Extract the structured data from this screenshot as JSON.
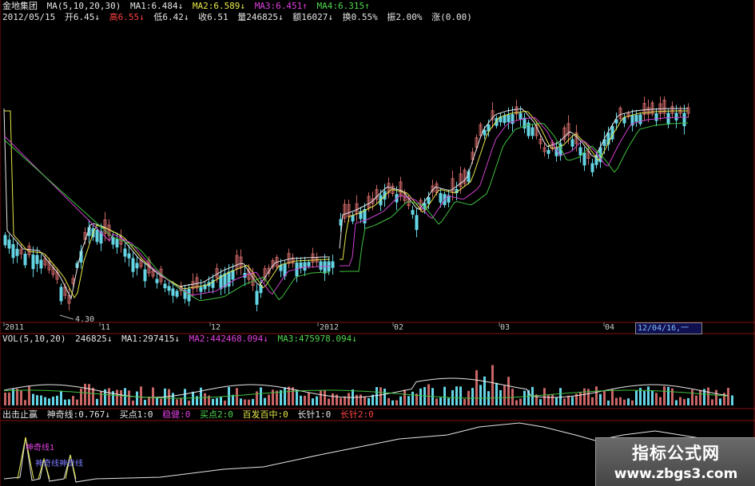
{
  "header": {
    "stock_name": "金地集团",
    "ma": "MA(5,10,20,30)",
    "ma1": "MA1:6.484↓",
    "ma2": "MA2:6.589↓",
    "ma3": "MA3:6.451↑",
    "ma4": "MA4:6.315↑",
    "date": "2012/05/15",
    "open": "开6.45↓",
    "high": "高6.55↓",
    "low": "低6.42↓",
    "close": "收6.51",
    "volume": "量246825↓",
    "amount": "额16027↓",
    "turnover": "换0.55%",
    "amplitude": "振2.00%",
    "change": "涨(0.00)"
  },
  "price_panel": {
    "low_marker": "4.30",
    "date_box": "12/04/16,一"
  },
  "x_axis": {
    "labels": [
      {
        "text": "2011",
        "pos": "l0"
      },
      {
        "text": "11",
        "pos": "l1"
      },
      {
        "text": "12",
        "pos": "l2"
      },
      {
        "text": "2012",
        "pos": "l3"
      },
      {
        "text": "02",
        "pos": "l4"
      },
      {
        "text": "03",
        "pos": "l5"
      },
      {
        "text": "04",
        "pos": "l6"
      }
    ]
  },
  "volume_panel": {
    "vol": "VOL(5,10,20)",
    "value": "246825↓",
    "ma1": "MA1:297415↓",
    "ma2": "MA2:442468.094↓",
    "ma3": "MA3:475978.094↓"
  },
  "indicator_panel": {
    "name": "出击止赢",
    "shenqi": "神奇线:0.767↓",
    "buy1": "买点1:0",
    "wenjian": "稳健:0",
    "buy2": "买点2:0",
    "baifa": "百发百中:0",
    "changzhen1": "长针1:0",
    "changzhen2": "长针2:0",
    "overlay1": "神奇线1",
    "overlay2": "神奇线神奇线"
  },
  "watermark": {
    "title": "指标公式网",
    "url": "www.zbgs3.com"
  },
  "colors": {
    "up": "#c86464",
    "down": "#64d4e4",
    "ma1": "#e6e6e6",
    "ma2": "#e6e64a",
    "ma3": "#d040d0",
    "ma4": "#40c040",
    "grid": "#8a1010"
  }
}
